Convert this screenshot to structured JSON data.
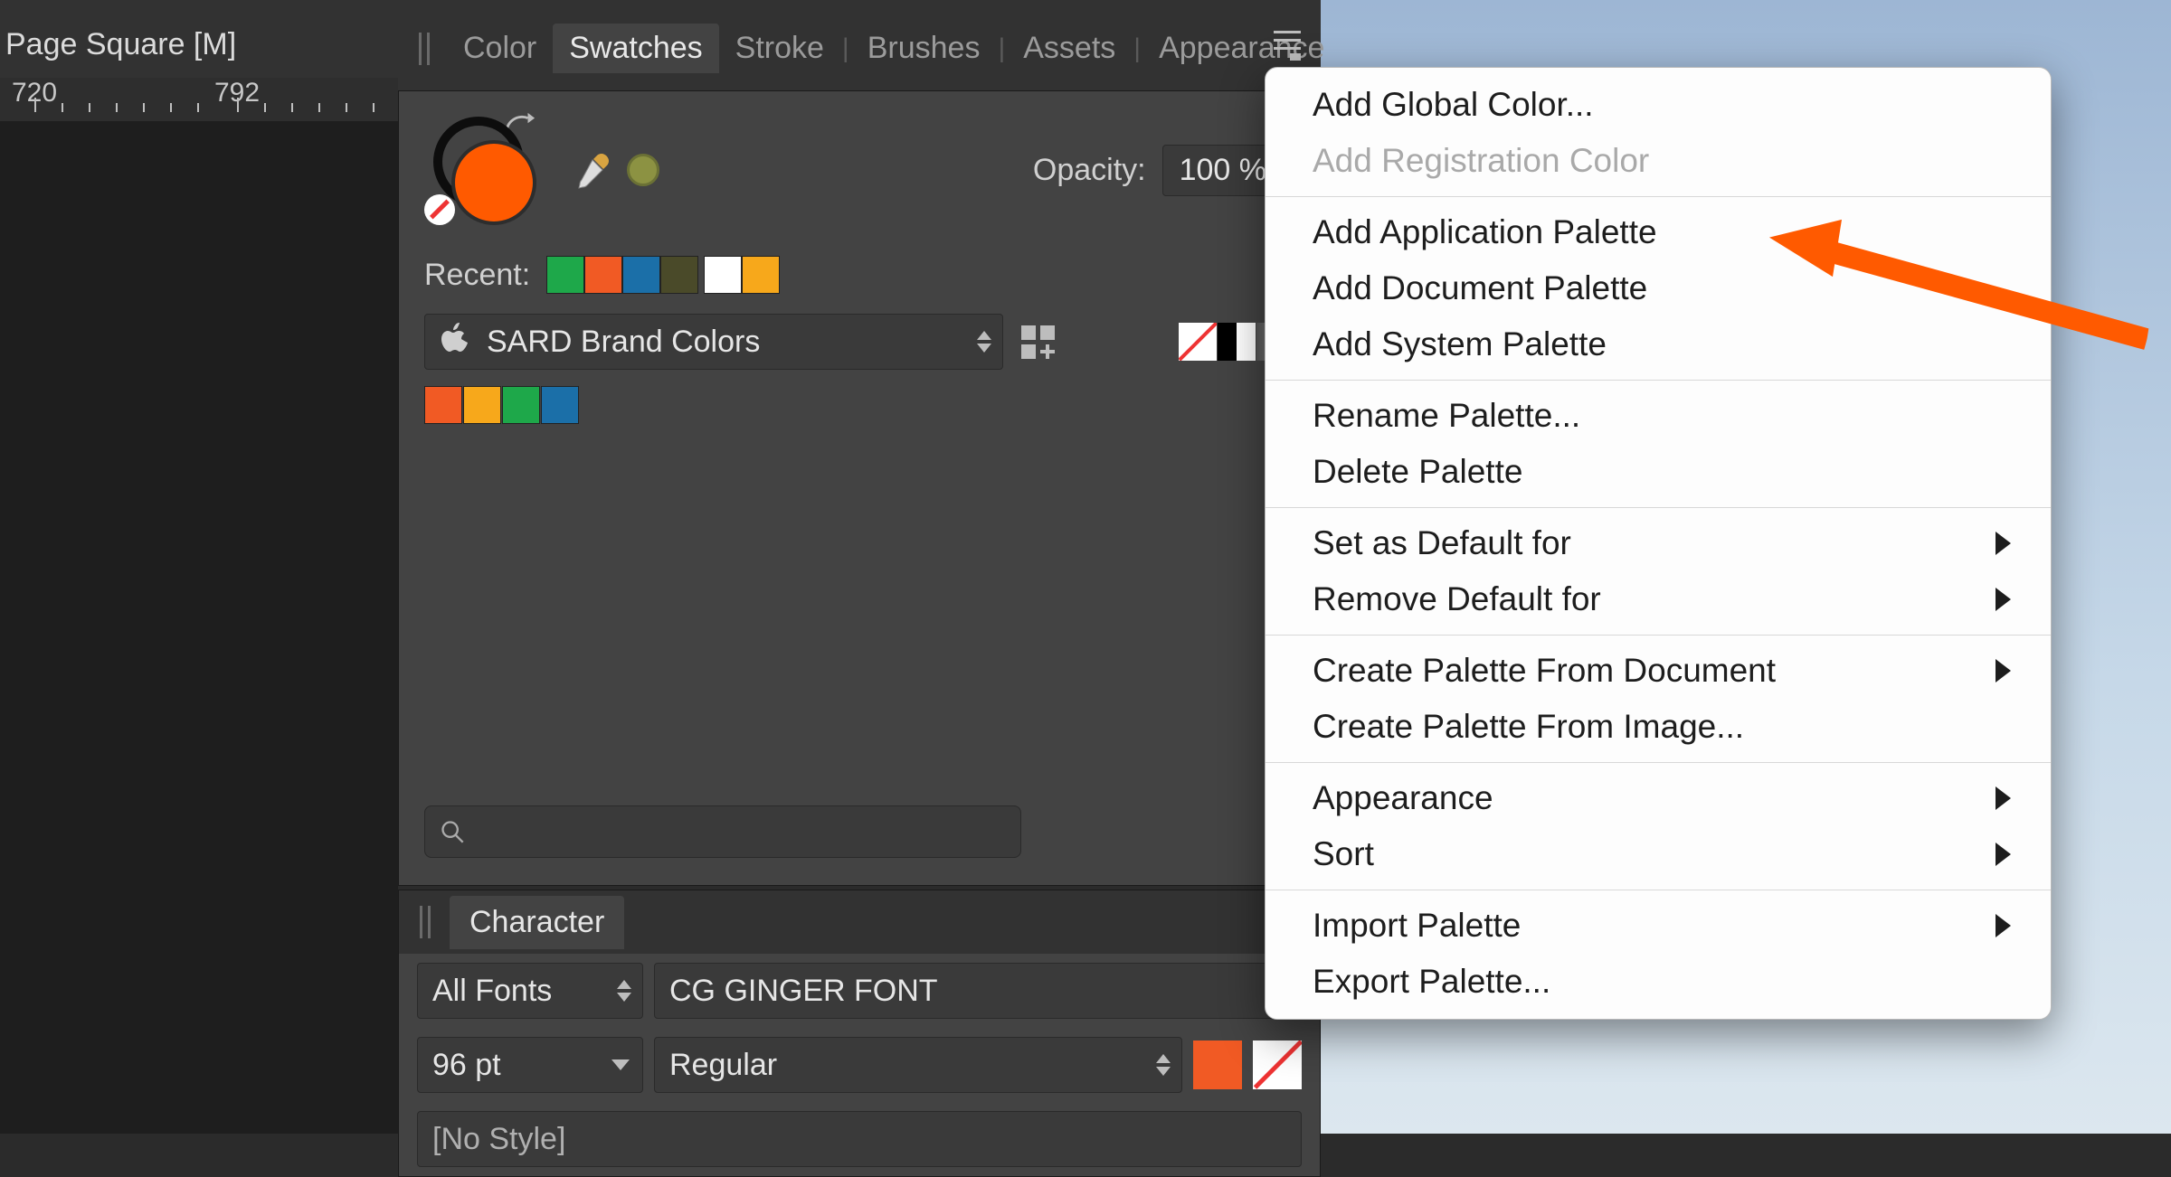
{
  "document": {
    "title": "Page Square [M]"
  },
  "ruler": {
    "marks": [
      "720",
      "792"
    ]
  },
  "panel": {
    "tabs": [
      "Color",
      "Swatches",
      "Stroke",
      "Brushes",
      "Assets",
      "Appearance"
    ],
    "active_tab": "Swatches",
    "opacity_label": "Opacity:",
    "opacity_value": "100 %",
    "recent_label": "Recent:",
    "recent_colors": [
      "#1ea84a",
      "#f15a24",
      "#1b6fa8",
      "#4a4a29",
      "#ffffff",
      "#f7a81b"
    ],
    "palette_name": "SARD Brand Colors",
    "palette_colors": [
      "#f15a24",
      "#f7a81b",
      "#1ea84a",
      "#1b6fa8"
    ],
    "search_placeholder": ""
  },
  "character": {
    "tab_label": "Character",
    "font_filter": "All Fonts",
    "font_name": "CG GINGER FONT",
    "font_size": "96 pt",
    "font_style": "Regular",
    "text_style": "[No Style]",
    "fill_color": "#f15a24"
  },
  "menu": {
    "groups": [
      [
        {
          "label": "Add Global Color...",
          "disabled": false,
          "submenu": false
        },
        {
          "label": "Add Registration Color",
          "disabled": true,
          "submenu": false
        }
      ],
      [
        {
          "label": "Add Application Palette",
          "disabled": false,
          "submenu": false
        },
        {
          "label": "Add Document Palette",
          "disabled": false,
          "submenu": false
        },
        {
          "label": "Add System Palette",
          "disabled": false,
          "submenu": false
        }
      ],
      [
        {
          "label": "Rename Palette...",
          "disabled": false,
          "submenu": false
        },
        {
          "label": "Delete Palette",
          "disabled": false,
          "submenu": false
        }
      ],
      [
        {
          "label": "Set as Default for",
          "disabled": false,
          "submenu": true
        },
        {
          "label": "Remove Default for",
          "disabled": false,
          "submenu": true
        }
      ],
      [
        {
          "label": "Create Palette From Document",
          "disabled": false,
          "submenu": true
        },
        {
          "label": "Create Palette From Image...",
          "disabled": false,
          "submenu": false
        }
      ],
      [
        {
          "label": "Appearance",
          "disabled": false,
          "submenu": true
        },
        {
          "label": "Sort",
          "disabled": false,
          "submenu": true
        }
      ],
      [
        {
          "label": "Import Palette",
          "disabled": false,
          "submenu": true
        },
        {
          "label": "Export Palette...",
          "disabled": false,
          "submenu": false
        }
      ]
    ]
  },
  "annotation": {
    "target": "Add Application Palette"
  }
}
